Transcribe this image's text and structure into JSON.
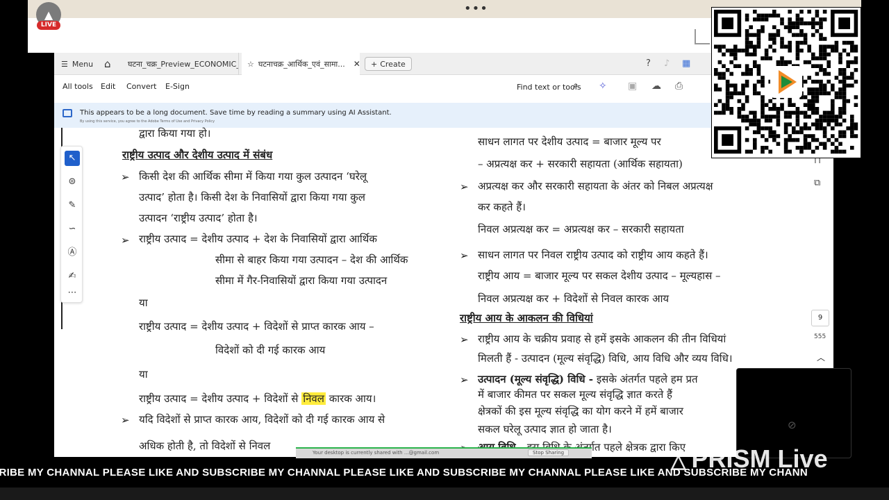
{
  "live": {
    "badge": "LIVE",
    "avatar_icon": "prism-logo-icon"
  },
  "top_dots": "•••",
  "tabs": {
    "menu": "Menu",
    "tab1": "घटना_चक्र_Preview_ECONOMIC_...",
    "tab2": "घटनाचक्र_आर्थिक_एवं_सामा...",
    "tab2_close": "✕",
    "create": "Create"
  },
  "toolbar": {
    "all_tools": "All tools",
    "edit": "Edit",
    "convert": "Convert",
    "esign": "E-Sign",
    "find": "Find text or tools"
  },
  "banner": {
    "text": "This appears to be a long document. Save time by reading a summary using AI Assistant.",
    "sub": "By using this service, you agree to the Adobe Terms of Use and Privacy Policy"
  },
  "doc": {
    "left": {
      "top_partial": "द्वारा किया गया हो।",
      "heading": "राष्ट्रीय उत्पाद और देशीय उत्पाद में संबंध",
      "p1_l1": "किसी देश की आर्थिक सीमा में किया गया कुल उत्पादन ‘घरेलू",
      "p1_l2": "उत्पाद’ होता है। किसी देश के निवासियों द्वारा किया गया कुल",
      "p1_l3": "उत्पादन ‘राष्ट्रीय उत्पाद’ होता है।",
      "p2_l1": "राष्ट्रीय उत्पाद = देशीय उत्पाद + देश के निवासियों द्वारा आर्थिक",
      "p2_l2": "सीमा से बाहर किया गया उत्पादन – देश की आर्थिक",
      "p2_l3": "सीमा में गैर-निवासियों द्वारा किया गया उत्पादन",
      "ya1": "या",
      "p3_l1": "राष्ट्रीय उत्पाद = देशीय उत्पाद + विदेशों से प्राप्त कारक आय –",
      "p3_l2": "विदेशों को दी गई कारक आय",
      "ya2": "या",
      "p4_pre": "राष्ट्रीय उत्पाद = देशीय उत्पाद + विदेशों से ",
      "p4_hl": "निवल",
      "p4_post": " कारक आय।",
      "p5_l1": "यदि विदेशों से प्राप्त कारक आय, विदेशों को दी गई कारक आय से",
      "p5_l2": "अधिक होती है, तो विदेशों से निवल"
    },
    "right": {
      "r1": "साधन लागत पर देशीय उत्पाद = बाजार मूल्य पर",
      "r2": "– अप्रत्यक्ष कर + सरकारी सहायता (आर्थिक सहायता)",
      "r3_l1": "अप्रत्यक्ष कर और सरकारी सहायता के अंतर को निबल अप्रत्यक्ष",
      "r3_l2": "कर कहते हैं।",
      "r4": "निवल अप्रत्यक्ष कर = अप्रत्यक्ष कर – सरकारी सहायता",
      "r5": "साधन लागत पर निवल  राष्ट्रीय उत्पाद को राष्ट्रीय आय कहते हैं।",
      "r6_l1": "राष्ट्रीय आय = बाजार मूल्य पर सकल देशीय उत्पाद – मूल्यहास –",
      "r6_l2": "निवल अप्रत्यक्ष कर + विदेशों से निवल कारक आय",
      "heading": "राष्ट्रीय आय के आकलन की विधियां",
      "r7_l1": "राष्ट्रीय आय के चक्रीय प्रवाह से हमें इसके आकलन की तीन विधियां",
      "r7_l2": "मिलती हैं - उत्पादन (मूल्य संवृद्धि) विधि, आय विधि और व्यय विधि।",
      "r8_bold": "उत्पादन (मूल्य संवृद्धि) विधि -",
      "r8_l1": " इसके अंतर्गत पहले हम प्रत",
      "r8_l2": "में बाजार कीमत पर सकल मूल्य संवृद्धि ज्ञात करते हैं",
      "r8_l3": "क्षेत्रकों की इस मूल्य संवृद्धि का योग करने में हमें बाजार",
      "r8_l4": "सकल घरेलू उत्पाद ज्ञात हो जाता है।",
      "r9_bold": "आय विधि -",
      "r9_l1": " इस विधि के अंतर्गत पहले क्षेत्रक द्वारा किए"
    }
  },
  "page_nav": {
    "current": "9",
    "total": "555"
  },
  "share_bar": {
    "text": "Your desktop is currently shared with ...@gmail.com",
    "stop": "Stop Sharing"
  },
  "ticker": "O SUBSCRIBE MY CHANNAL   PLEASE LIKE AND SUBSCRIBE MY CHANNAL   PLEASE LIKE AND SUBSCRIBE MY CHANNAL   PLEASE LIKE AND SUBSCRIBE MY CHANN",
  "prism": "PRISM Live",
  "colors": {
    "accent": "#1f5fcb",
    "highlight": "#ffec3d",
    "live_red": "#d62b2b",
    "banner_bg": "#e6f0fb"
  }
}
